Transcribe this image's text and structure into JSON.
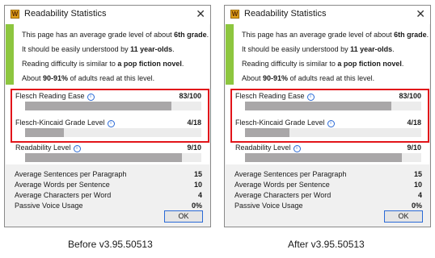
{
  "dialogs": [
    {
      "title": "Readability Statistics",
      "summary": [
        {
          "pre": "This page has an average grade level of about ",
          "bold": "6th grade",
          "post": "."
        },
        {
          "pre": "It should be easily understood by ",
          "bold": "11 year-olds",
          "post": "."
        },
        {
          "pre": "Reading difficulty is similar to ",
          "bold": "a pop fiction novel",
          "post": "."
        },
        {
          "pre": "About ",
          "bold": "90-91%",
          "post": " of adults read at this level."
        }
      ],
      "metrics": [
        {
          "label": "Flesch Reading Ease",
          "value": "83/100",
          "fraction": 0.83
        },
        {
          "label": "Flesch-Kincaid Grade Level",
          "value": "4/18",
          "fraction": 0.22
        },
        {
          "label": "Readability Level",
          "value": "9/10",
          "fraction": 0.89
        }
      ],
      "stats": [
        {
          "label": "Average Sentences per Paragraph",
          "value": "15"
        },
        {
          "label": "Average Words per Sentence",
          "value": "10"
        },
        {
          "label": "Average Characters per Word",
          "value": "4"
        },
        {
          "label": "Passive Voice Usage",
          "value": "0%"
        }
      ],
      "ok_label": "OK"
    },
    {
      "title": "Readability Statistics",
      "summary": [
        {
          "pre": "This page has an average grade level of about ",
          "bold": "6th grade",
          "post": "."
        },
        {
          "pre": "It should be easily understood by ",
          "bold": "11 year-olds",
          "post": "."
        },
        {
          "pre": "Reading difficulty is similar to ",
          "bold": "a pop fiction novel",
          "post": "."
        },
        {
          "pre": "About ",
          "bold": "90-91%",
          "post": " of adults read at this level."
        }
      ],
      "metrics": [
        {
          "label": "Flesch Reading Ease",
          "value": "83/100",
          "fraction": 0.83
        },
        {
          "label": "Flesch-Kincaid Grade Level",
          "value": "4/18",
          "fraction": 0.25
        },
        {
          "label": "Readability Level",
          "value": "9/10",
          "fraction": 0.89
        }
      ],
      "stats": [
        {
          "label": "Average Sentences per Paragraph",
          "value": "15"
        },
        {
          "label": "Average Words per Sentence",
          "value": "10"
        },
        {
          "label": "Average Characters per Word",
          "value": "4"
        },
        {
          "label": "Passive Voice Usage",
          "value": "0%"
        }
      ],
      "ok_label": "OK"
    }
  ],
  "captions": [
    "Before v3.95.50513",
    "After v3.95.50513"
  ],
  "colors": {
    "accent_green": "#8dc63f",
    "highlight_red": "#e2141a",
    "bar_fill": "#a9a7a8",
    "focus_blue": "#2a6ad6"
  },
  "icons": {
    "app": "w-app-icon",
    "info": "info-icon",
    "close": "close-icon"
  }
}
